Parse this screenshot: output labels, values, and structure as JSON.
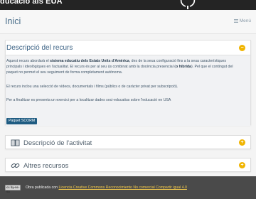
{
  "site": {
    "title": "ducació als EUA"
  },
  "header": {
    "page_title": "Inici",
    "menu_label": "Menú"
  },
  "main_panel": {
    "title": "Descripció del recurs",
    "toggle": "−",
    "p1_a": "Aquest recurs abordarà el ",
    "p1_b": "sistema educatiu dels Estats Units d'Amèrica",
    "p1_c": ", des de la seua configuració fins a la seua",
    "p1_line2": "característiques principals i ideològiques en l'actualitat. El recurs és per al seu ús combinat amb la docència presencial (",
    "p1_line2_b": "o",
    "p1_line3_b": "híbrida",
    "p1_line3": "). Pel que el contingut del paquet no permet el seu seguiment de forma completament autònoma.",
    "p2": "El recurs inclou una selecció de vídeos, documentals i films (públics o de caràcter privat per subscripció).",
    "p3": "Per a finalitzar es presenta un exercici per a localitzar dades soci-educatius sobre l'educació en USA",
    "button": "Paquet SCORM"
  },
  "panels": [
    {
      "title": "Descripció de l'activitat",
      "icon": "book-icon",
      "toggle": "+"
    },
    {
      "title": "Altres recursos",
      "icon": "link-icon",
      "toggle": "+"
    }
  ],
  "footer": {
    "badge": "cc by-nc-sa",
    "prefix": "Obra publicada con ",
    "license_link": "Licencia Creative Commons Reconocimiento No comercial Compartir igual 4.0"
  },
  "colors": {
    "accent": "#f0b400",
    "title_blue": "#3d6385",
    "button": "#1f5c82",
    "topbar": "#242424",
    "footer": "#4a4a4a"
  }
}
